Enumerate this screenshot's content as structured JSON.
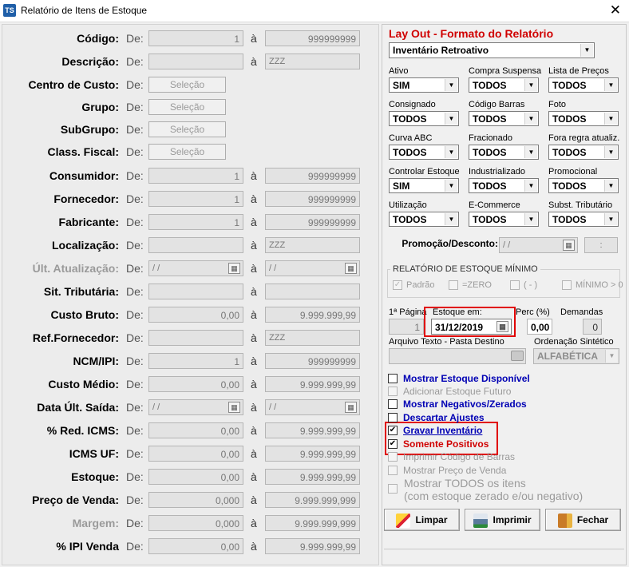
{
  "window": {
    "icon_text": "TS",
    "title": "Relatório de Itens de Estoque",
    "close_glyph": "✕"
  },
  "left": {
    "de_label": "De:",
    "a_label": "à",
    "selecao_label": "Seleção",
    "rows": [
      {
        "label": "Código:",
        "from": "1",
        "to": "999999999"
      },
      {
        "label": "Descrição:",
        "from": "",
        "to": "ZZZ"
      },
      {
        "label": "Centro de Custo:"
      },
      {
        "label": "Grupo:"
      },
      {
        "label": "SubGrupo:"
      },
      {
        "label": "Class. Fiscal:"
      },
      {
        "label": "Consumidor:",
        "from": "1",
        "to": "999999999"
      },
      {
        "label": "Fornecedor:",
        "from": "1",
        "to": "999999999"
      },
      {
        "label": "Fabricante:",
        "from": "1",
        "to": "999999999"
      },
      {
        "label": "Localização:",
        "from": "",
        "to": "ZZZ"
      },
      {
        "label": "Últ. Atualização:",
        "from": "/ /",
        "to": "/ /"
      },
      {
        "label": "Sit. Tributária:",
        "from": "",
        "to": ""
      },
      {
        "label": "Custo Bruto:",
        "from": "0,00",
        "to": "9.999.999,99"
      },
      {
        "label": "Ref.Fornecedor:",
        "from": "",
        "to": "ZZZ"
      },
      {
        "label": "NCM/IPI:",
        "from": "1",
        "to": "999999999"
      },
      {
        "label": "Custo Médio:",
        "from": "0,00",
        "to": "9.999.999,99"
      },
      {
        "label": "Data Últ. Saída:",
        "from": "/ /",
        "to": "/ /"
      },
      {
        "label": "% Red. ICMS:",
        "from": "0,00",
        "to": "9.999.999,99"
      },
      {
        "label": "ICMS UF:",
        "from": "0,00",
        "to": "9.999.999,99"
      },
      {
        "label": "Estoque:",
        "from": "0,00",
        "to": "9.999.999,99"
      },
      {
        "label": "Preço de Venda:",
        "from": "0,000",
        "to": "9.999.999,999"
      },
      {
        "label": "Margem:",
        "from": "0,000",
        "to": "9.999.999,999"
      },
      {
        "label": "% IPI Venda",
        "from": "0,00",
        "to": "9.999.999,99"
      }
    ]
  },
  "right": {
    "layout_title": "Lay Out - Formato do Relatório",
    "layout_value": "Inventário Retroativo",
    "filters": [
      {
        "label": "Ativo",
        "value": "SIM"
      },
      {
        "label": "Compra Suspensa",
        "value": "TODOS"
      },
      {
        "label": "Lista de Preços",
        "value": "TODOS"
      },
      {
        "label": "Consignado",
        "value": "TODOS"
      },
      {
        "label": "Código Barras",
        "value": "TODOS"
      },
      {
        "label": "Foto",
        "value": "TODOS"
      },
      {
        "label": "Curva ABC",
        "value": "TODOS"
      },
      {
        "label": "Fracionado",
        "value": "TODOS"
      },
      {
        "label": "Fora regra atualiz.",
        "value": "TODOS"
      },
      {
        "label": "Controlar Estoque",
        "value": "SIM"
      },
      {
        "label": "Industrializado",
        "value": "TODOS"
      },
      {
        "label": "Promocional",
        "value": "TODOS"
      },
      {
        "label": "Utilização",
        "value": "TODOS"
      },
      {
        "label": "E-Commerce",
        "value": "TODOS"
      },
      {
        "label": "Subst. Tributário",
        "value": "TODOS"
      }
    ],
    "promo_label": "Promoção/Desconto:",
    "promo_date": "/ /",
    "promo_time": ":",
    "min_stock_title": "RELATÓRIO DE ESTOQUE MÍNIMO",
    "min_stock_options": [
      {
        "label": "Padrão",
        "checked": true
      },
      {
        "label": "=ZERO",
        "checked": false
      },
      {
        "label": "( - )",
        "checked": false
      },
      {
        "label": "MÍNIMO > 0",
        "checked": false
      }
    ],
    "first_page_label": "1ª Página",
    "first_page_value": "1",
    "stock_date_label": "Estoque em:",
    "stock_date_value": "31/12/2019",
    "perc_label": "Perc (%)",
    "perc_value": "0,00",
    "demandas_label": "Demandas",
    "demandas_value": "0",
    "file_label": "Arquivo Texto - Pasta Destino",
    "file_value": "",
    "order_label": "Ordenação Sintético",
    "order_value": "ALFABÉTICA",
    "options": [
      {
        "label": "Mostrar Estoque Disponível",
        "checked": false,
        "state": "active"
      },
      {
        "label": "Adicionar Estoque Futuro",
        "checked": false,
        "state": "disabled"
      },
      {
        "label": "Mostrar Negativos/Zerados",
        "checked": false,
        "state": "active"
      },
      {
        "label": "Descartar Ajustes",
        "checked": false,
        "state": "active"
      },
      {
        "label": "Gravar Inventário",
        "checked": true,
        "state": "active"
      },
      {
        "label": "Somente Positivos",
        "checked": true,
        "state": "highlight"
      },
      {
        "label": "Imprimir Código de Barras",
        "checked": false,
        "state": "disabled"
      },
      {
        "label": "Mostrar Preço de Venda",
        "checked": false,
        "state": "disabled"
      }
    ],
    "show_all_line1": "Mostrar TODOS os itens",
    "show_all_line2": "(com estoque zerado e/ou negativo)",
    "buttons": {
      "limpar": "Limpar",
      "imprimir": "Imprimir",
      "fechar": "Fechar"
    },
    "colors": {
      "title_red": "#d00000",
      "option_blue": "#0000b4",
      "highlight": "#e00000"
    }
  }
}
